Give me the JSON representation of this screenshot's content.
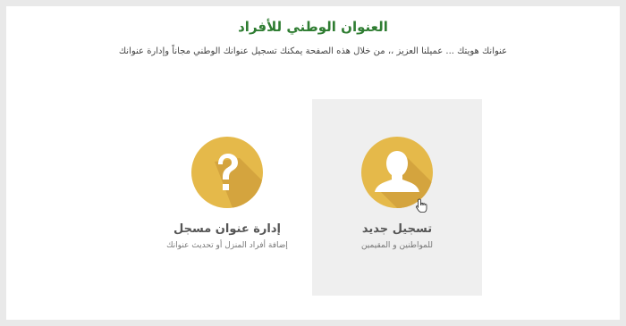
{
  "page": {
    "title": "العنوان الوطني للأفراد",
    "intro": "عنوانك هويتك ... عميلنا العزيز ،، من خلال هذه الصفحة يمكنك تسجيل عنوانك الوطني مجاناً وإدارة عنوانك"
  },
  "cards": {
    "register": {
      "title": "تسجيل جديد",
      "subtitle": "للمواطنين و المقيمين",
      "icon": "user-silhouette-icon"
    },
    "manage": {
      "title": "إدارة عنوان مسجل",
      "subtitle": "إضافة أفراد المنزل أو تحديث عنوانك",
      "icon": "question-mark-icon"
    }
  },
  "colors": {
    "accent_green": "#2f7d32",
    "icon_gold": "#e5b94a",
    "active_card_bg": "#efefef"
  }
}
